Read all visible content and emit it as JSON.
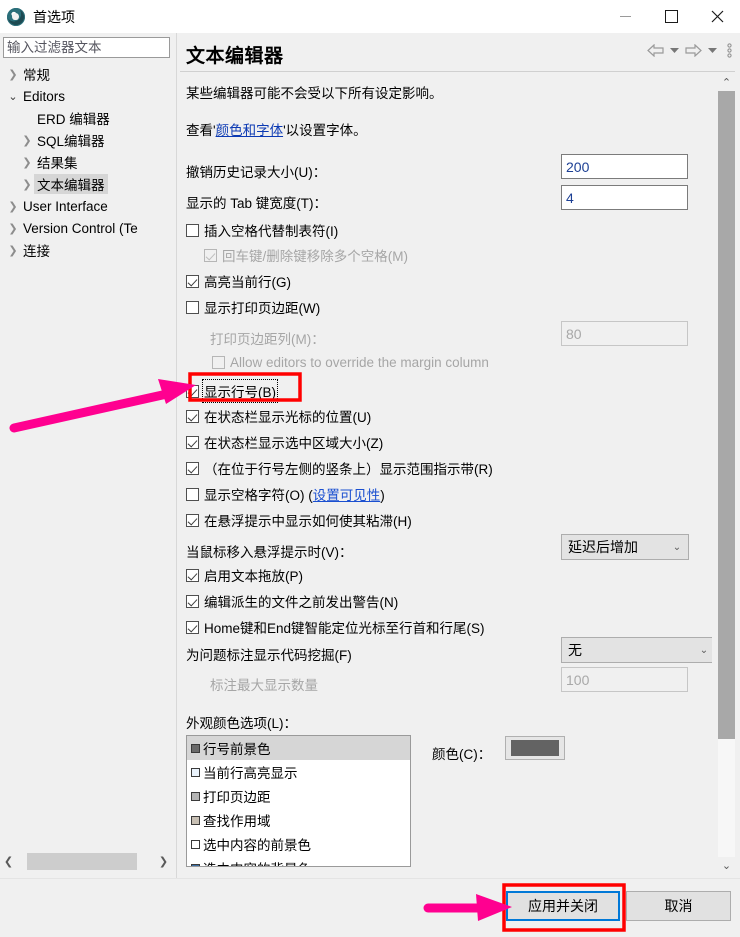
{
  "window": {
    "title": "首选项",
    "icon": "dbeaver-app-icon",
    "minimize_label": "最小化",
    "maximize_label": "最大化",
    "close_label": "关闭"
  },
  "sidebar": {
    "filter_placeholder": "输入过滤器文本",
    "filter_value": "",
    "items": [
      {
        "label": "常规",
        "indent": 0,
        "state": "collapsed",
        "selected": false
      },
      {
        "label": "Editors",
        "indent": 0,
        "state": "expanded",
        "selected": false
      },
      {
        "label": "ERD 编辑器",
        "indent": 1,
        "state": "leaf",
        "selected": false
      },
      {
        "label": "SQL编辑器",
        "indent": 1,
        "state": "collapsed",
        "selected": false
      },
      {
        "label": "结果集",
        "indent": 1,
        "state": "collapsed",
        "selected": false
      },
      {
        "label": "文本编辑器",
        "indent": 1,
        "state": "collapsed",
        "selected": true
      },
      {
        "label": "User Interface",
        "indent": 0,
        "state": "collapsed",
        "selected": false
      },
      {
        "label": "Version Control (Te",
        "indent": 0,
        "state": "collapsed",
        "selected": false
      },
      {
        "label": "连接",
        "indent": 0,
        "state": "collapsed",
        "selected": false
      }
    ],
    "hscroll_left_icon": "chevron-left-icon",
    "hscroll_right_icon": "chevron-right-icon"
  },
  "page": {
    "title": "文本编辑器",
    "nav": {
      "back_icon": "arrow-left-icon",
      "back_menu_icon": "chevron-down-icon",
      "forward_icon": "arrow-right-icon",
      "forward_menu_icon": "chevron-down-icon",
      "overflow_icon": "vertical-ellipsis-icon"
    },
    "intro": "某些编辑器可能不会受以下所有设定影响。",
    "link_line_prefix": "查看'",
    "link_text": "颜色和字体",
    "link_line_suffix": "'以设置字体。",
    "fields": [
      {
        "label": "撤销历史记录大小(U)：",
        "value": "200",
        "enabled": true
      },
      {
        "label": "显示的 Tab 键宽度(T)：",
        "value": "4",
        "enabled": true
      }
    ],
    "checkboxes": [
      {
        "label": "插入空格代替制表符(I)",
        "checked": false,
        "enabled": true,
        "indent": 0
      },
      {
        "label": "回车键/删除键移除多个空格(M)",
        "checked": true,
        "enabled": false,
        "indent": 1
      },
      {
        "label": "高亮当前行(G)",
        "checked": true,
        "enabled": true,
        "indent": 0
      },
      {
        "label": "显示打印页边距(W)",
        "checked": false,
        "enabled": true,
        "indent": 0
      }
    ],
    "margin_column": {
      "label": "打印页边距列(M)：",
      "value": "80",
      "enabled": false
    },
    "allow_override": {
      "label": "Allow editors to override the margin column",
      "checked": false,
      "enabled": false
    },
    "show_line_numbers": {
      "label": "显示行号(B)",
      "checked": true,
      "focused": true,
      "highlighted": true
    },
    "checkboxes2": [
      {
        "label": "在状态栏显示光标的位置(U)",
        "checked": true
      },
      {
        "label": "在状态栏显示选中区域大小(Z)",
        "checked": true
      },
      {
        "label": "（在位于行号左侧的竖条上）显示范围指示带(R)",
        "checked": true
      }
    ],
    "whitespace_row": {
      "prefix": "显示空格字符(O) (",
      "link": "设置可见性",
      "suffix": ")",
      "checked": false
    },
    "checkboxes3": [
      {
        "label": "在悬浮提示中显示如何使其粘滞(H)",
        "checked": true
      }
    ],
    "hover_combo": {
      "label": "当鼠标移入悬浮提示时(V)：",
      "value": "延迟后增加"
    },
    "checkboxes4": [
      {
        "label": "启用文本拖放(P)",
        "checked": true
      },
      {
        "label": "编辑派生的文件之前发出警告(N)",
        "checked": true
      },
      {
        "label": "Home键和End键智能定位光标至行首和行尾(S)",
        "checked": true
      }
    ],
    "quickdiff_combo": {
      "label": "为问题标注显示代码挖掘(F)",
      "value": "无"
    },
    "max_annotations": {
      "label": "标注最大显示数量",
      "value": "100",
      "enabled": false
    },
    "appearance": {
      "label": "外观颜色选项(L)：",
      "items": [
        {
          "label": "行号前景色",
          "swatch": "#6b6b6b",
          "selected": true
        },
        {
          "label": "当前行高亮显示",
          "swatch": "#e8f2fb",
          "selected": false
        },
        {
          "label": "打印页边距",
          "swatch": "#b4b4b4",
          "selected": false
        },
        {
          "label": "查找作用域",
          "swatch": "#c8c0b4",
          "selected": false
        },
        {
          "label": "选中内容的前景色",
          "swatch": "#ffffff",
          "selected": false
        },
        {
          "label": "选中内容的背景色",
          "swatch": "#3a6ea5",
          "selected": false
        }
      ],
      "color_label": "颜色(C)：",
      "color_value": "#636363"
    },
    "scroll_up_icon": "chevron-up-icon",
    "scroll_down_icon": "chevron-down-icon"
  },
  "footer": {
    "apply_close_label": "应用并关闭",
    "cancel_label": "取消"
  },
  "annotations": {
    "accent_color": "#ff0000",
    "arrow_color": "#ff0090",
    "arrow1_name": "pointer-arrow-to-line-numbers-checkbox",
    "arrow2_name": "pointer-arrow-to-apply-button"
  }
}
